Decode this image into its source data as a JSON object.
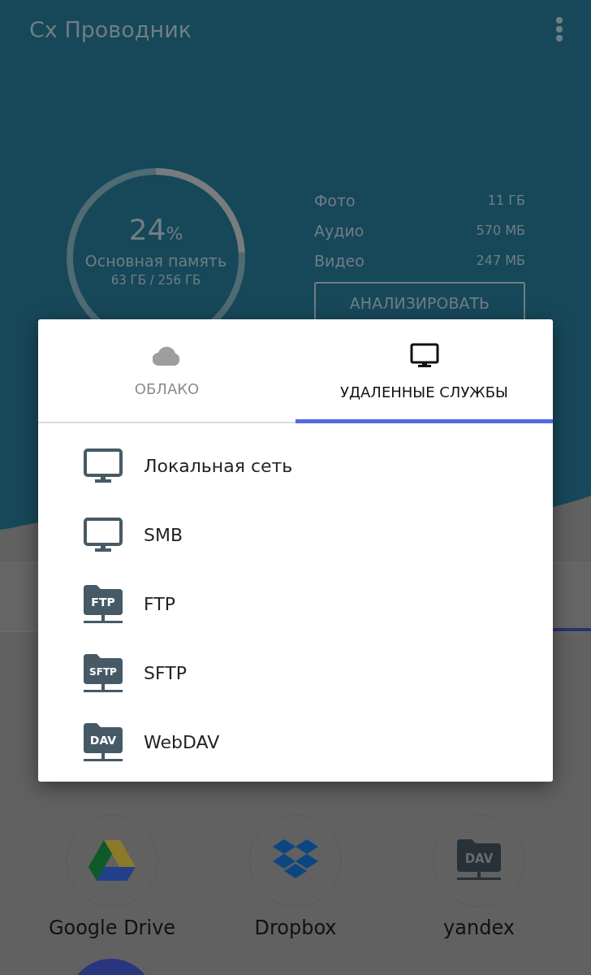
{
  "app_bar": {
    "title": "Сх Проводник"
  },
  "storage": {
    "percent": "24",
    "percent_sign": "%",
    "label": "Основная память",
    "usage": "63 ГБ / 256 ГБ",
    "level": 0.24,
    "categories": [
      {
        "name": "Фото",
        "size": "11 ГБ"
      },
      {
        "name": "Аудио",
        "size": "570 МБ"
      },
      {
        "name": "Видео",
        "size": "247 МБ"
      }
    ],
    "analyze_button": "АНАЛИЗИРОВАТЬ"
  },
  "apps": [
    {
      "kind": "drive",
      "label": "Google Drive"
    },
    {
      "kind": "dropbox",
      "label": "Dropbox"
    },
    {
      "kind": "folder",
      "icon_text": "DAV",
      "label": "yandex"
    }
  ],
  "dialog": {
    "tabs": [
      {
        "kind": "cloud",
        "label": "ОБЛАКО",
        "selected": false
      },
      {
        "kind": "monitor",
        "label": "УДАЛЕННЫЕ СЛУЖБЫ",
        "selected": true
      }
    ],
    "items": [
      {
        "kind": "monitor",
        "label": "Локальная сеть"
      },
      {
        "kind": "monitor",
        "label": "SMB"
      },
      {
        "kind": "folder",
        "icon_text": "FTP",
        "label": "FTP"
      },
      {
        "kind": "folder",
        "icon_text": "SFTP",
        "label": "SFTP"
      },
      {
        "kind": "folder",
        "icon_text": "DAV",
        "label": "WebDAV"
      }
    ]
  }
}
